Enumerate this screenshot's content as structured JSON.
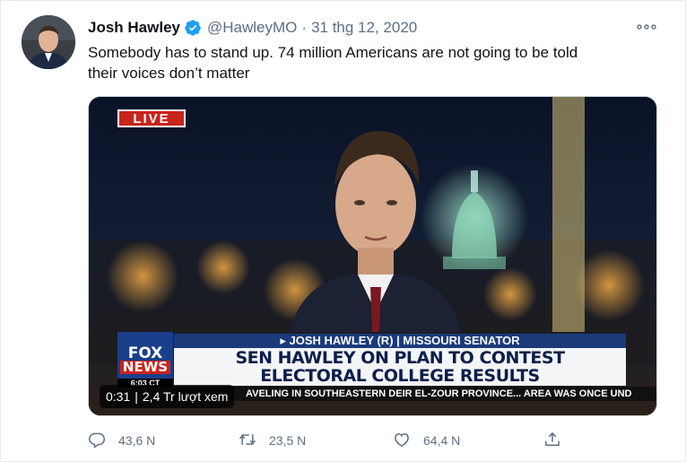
{
  "tweet": {
    "author_name": "Josh Hawley",
    "handle": "@HawleyMO",
    "separator": "·",
    "date": "31 thg 12, 2020",
    "text_line1": "Somebody has to stand up. 74 million Americans are not going to be told",
    "text_line2": "their voices don’t matter",
    "verified_icon": "verified-badge-icon",
    "more_icon": "more-dots-icon"
  },
  "video": {
    "live_label": "LIVE",
    "fox_label": "FOX",
    "news_label": "NEWS",
    "clock": "6:03 CT",
    "lower_third_top": "▸ JOSH HAWLEY (R) | MISSOURI SENATOR",
    "headline_line1": "SEN HAWLEY ON PLAN TO CONTEST",
    "headline_line2": "ELECTORAL COLLEGE RESULTS",
    "ticker": "AVELING IN SOUTHEASTERN DEIR EL-ZOUR PROVINCE...   AREA WAS ONCE UND",
    "elapsed": "0:31",
    "sep": "|",
    "views": "2,4 Tr lượt xem"
  },
  "actions": {
    "replies": "43,6 N",
    "retweets": "23,5 N",
    "likes": "64,4 N",
    "reply_icon": "reply-icon",
    "retweet_icon": "retweet-icon",
    "like_icon": "heart-icon",
    "share_icon": "share-icon"
  },
  "colors": {
    "verified": "#1da1f2",
    "secondary_text": "#5b7083",
    "live_red": "#c8241d",
    "fox_blue": "#1a3f8a"
  }
}
